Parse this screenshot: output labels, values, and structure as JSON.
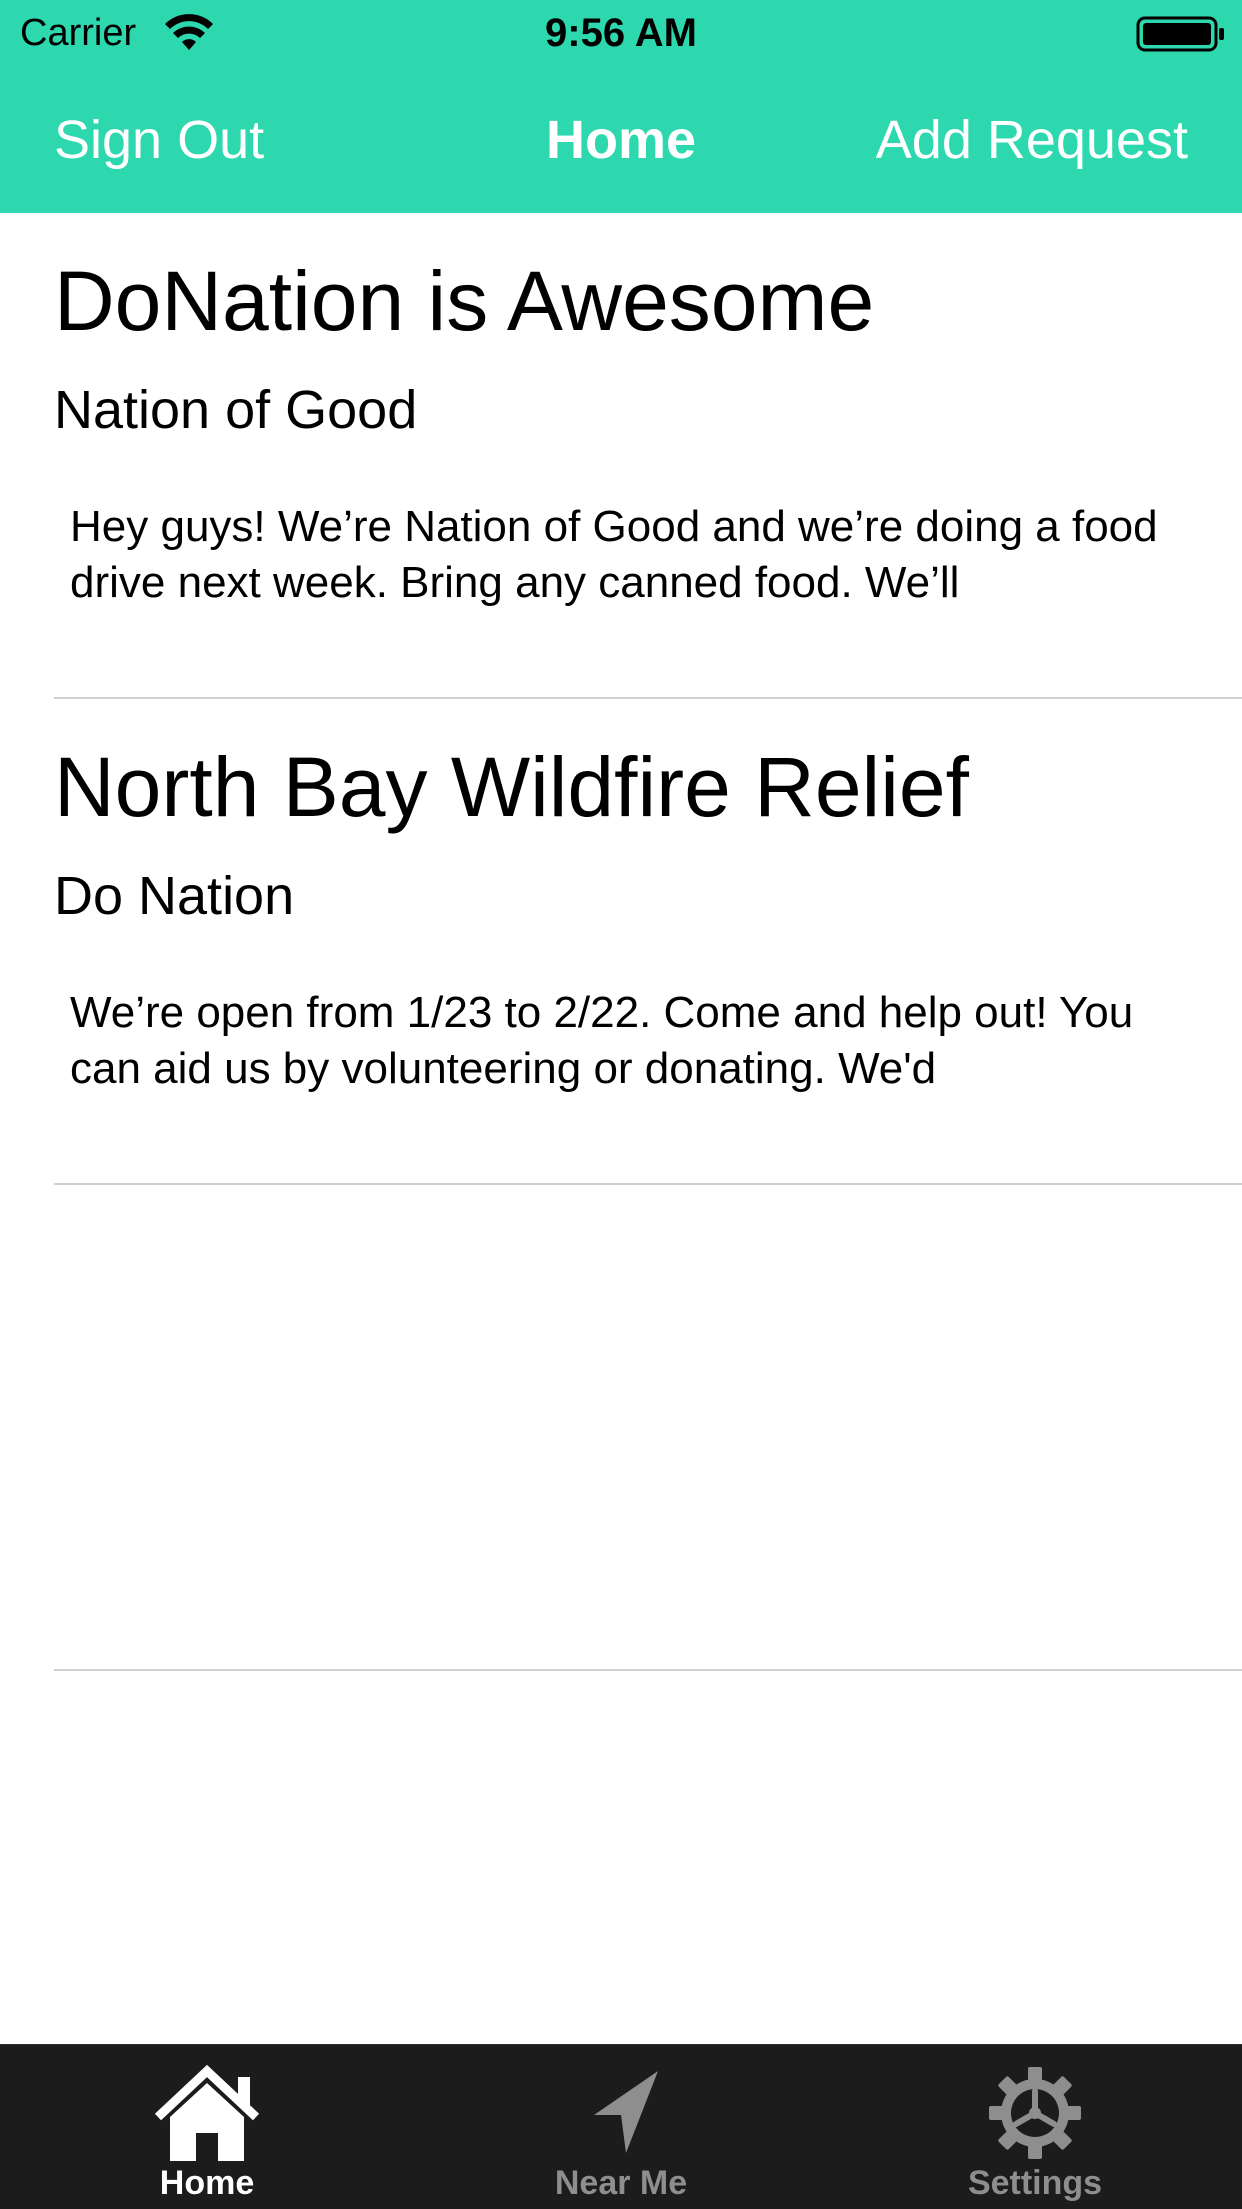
{
  "status_bar": {
    "carrier": "Carrier",
    "time": "9:56 AM"
  },
  "nav": {
    "left_button": "Sign Out",
    "title": "Home",
    "right_button": "Add Request",
    "background_color": "#2ed8af"
  },
  "requests": [
    {
      "title": "DoNation is Awesome",
      "organization": "Nation of Good",
      "description": "Hey guys! We’re Nation of Good and we’re doing a food drive next week. Bring any canned food. We’ll"
    },
    {
      "title": "North Bay Wildfire Relief",
      "organization": "Do Nation",
      "description": "We’re open from 1/23 to 2/22. Come and help out! You can aid us by volunteering or donating. We'd"
    },
    {
      "title": "",
      "organization": "",
      "description": ""
    }
  ],
  "tab_bar": {
    "tabs": [
      {
        "label": "Home",
        "icon": "house-icon",
        "active": true
      },
      {
        "label": "Near Me",
        "icon": "location-arrow-icon",
        "active": false
      },
      {
        "label": "Settings",
        "icon": "gear-icon",
        "active": false
      }
    ]
  }
}
